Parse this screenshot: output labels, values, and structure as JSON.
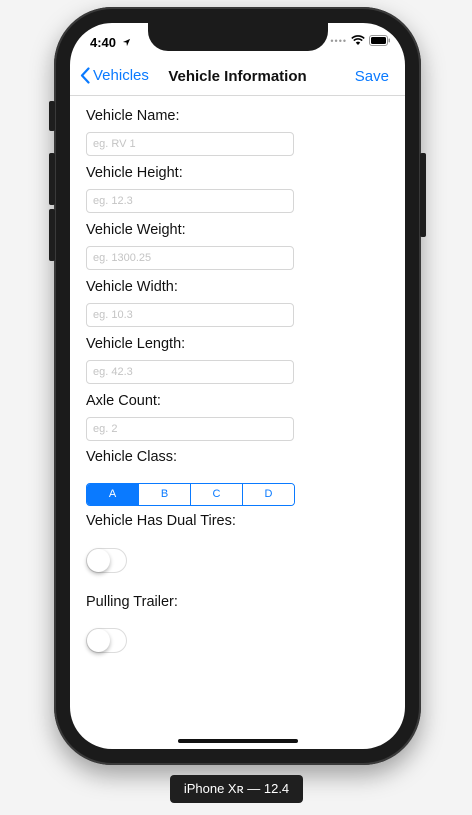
{
  "status_bar": {
    "time": "4:40"
  },
  "navbar": {
    "back_label": "Vehicles",
    "title": "Vehicle Information",
    "save_label": "Save"
  },
  "form": {
    "fields": [
      {
        "label": "Vehicle Name:",
        "placeholder": "eg. RV 1"
      },
      {
        "label": "Vehicle Height:",
        "placeholder": "eg. 12.3"
      },
      {
        "label": "Vehicle Weight:",
        "placeholder": "eg. 1300.25"
      },
      {
        "label": "Vehicle Width:",
        "placeholder": "eg. 10.3"
      },
      {
        "label": "Vehicle Length:",
        "placeholder": "eg. 42.3"
      },
      {
        "label": "Axle Count:",
        "placeholder": "eg. 2"
      }
    ],
    "vehicle_class": {
      "label": "Vehicle Class:",
      "options": [
        "A",
        "B",
        "C",
        "D"
      ],
      "selected": "A"
    },
    "dual_tires": {
      "label": "Vehicle Has Dual Tires:",
      "on": false
    },
    "pulling_trailer": {
      "label": "Pulling Trailer:",
      "on": false
    }
  },
  "device_label": "iPhone Xʀ — 12.4",
  "colors": {
    "accent": "#0a7aff",
    "device": "#1b1b1b"
  },
  "icons": [
    "location-arrow-icon",
    "signal-dots-icon",
    "wifi-icon",
    "battery-icon",
    "chevron-left-icon"
  ]
}
